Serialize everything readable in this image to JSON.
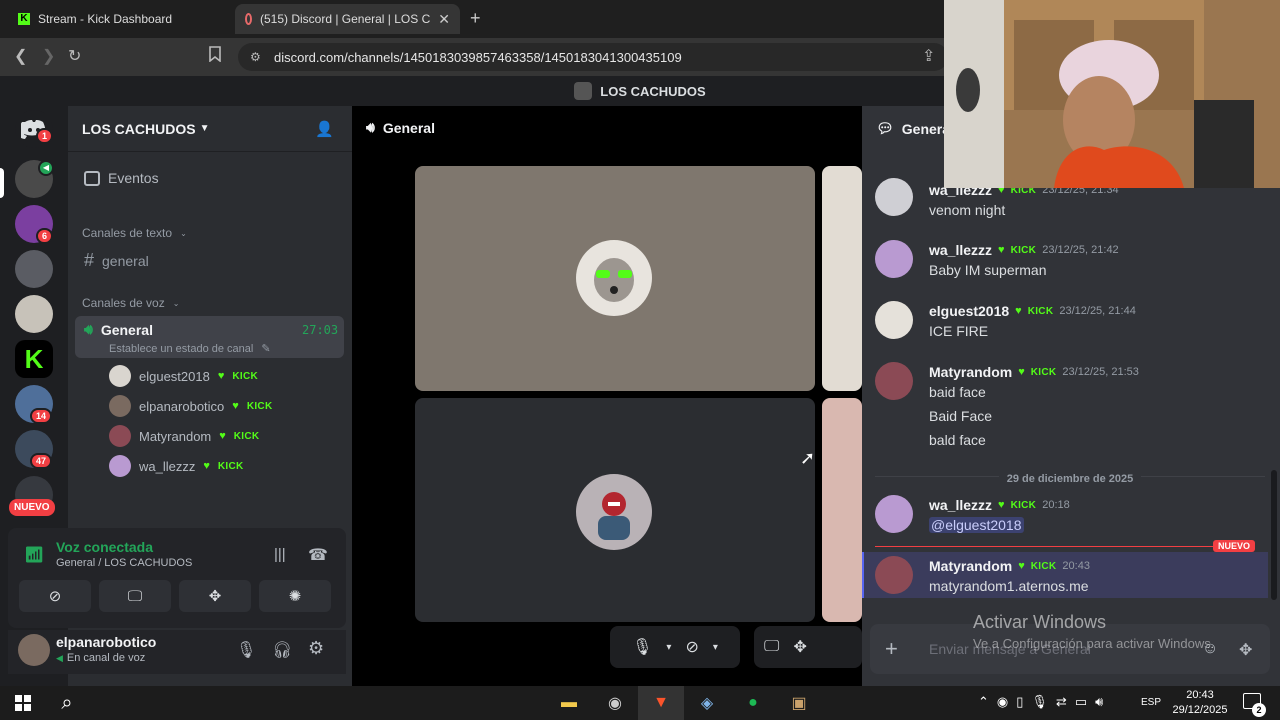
{
  "browser": {
    "tab1_label": "Stream - Kick Dashboard",
    "tab2_label": "(515) Discord | General | LOS C",
    "url": "discord.com/channels/1450183039857463358/1450183041300435109"
  },
  "discord": {
    "window_title": "LOS CACHUDOS",
    "rail_badges": [
      "1",
      "6",
      "14",
      "47"
    ],
    "rail_new_label": "NUEVO",
    "server_name": "LOS CACHUDOS",
    "events_label": "Eventos",
    "text_category": "Canales de texto",
    "text_channel": "general",
    "voice_category": "Canales de voz",
    "voice_channel": "General",
    "voice_timer": "27:03",
    "voice_status": "Establece un estado de canal",
    "voice_users": [
      {
        "name": "elguest2018",
        "tag": "KICK"
      },
      {
        "name": "elpanarobotico",
        "tag": "KICK"
      },
      {
        "name": "Matyrandom",
        "tag": "KICK"
      },
      {
        "name": "wa_llezzz",
        "tag": "KICK"
      }
    ],
    "voice_panel": {
      "title": "Voz conectada",
      "subtitle": "General / LOS CACHUDOS"
    },
    "user": {
      "name": "elpanarobotico",
      "status": "En canal de voz"
    },
    "stage_title": "General",
    "chat_title": "General",
    "messages": [
      {
        "author": "wa_llezzz",
        "tag": "KICK",
        "time": "23/12/25, 21:34",
        "lines": [
          "venom night"
        ]
      },
      {
        "author": "wa_llezzz",
        "tag": "KICK",
        "time": "23/12/25, 21:42",
        "lines": [
          "Baby IM superman"
        ]
      },
      {
        "author": "elguest2018",
        "tag": "KICK",
        "time": "23/12/25, 21:44",
        "lines": [
          "ICE FIRE"
        ]
      },
      {
        "author": "Matyrandom",
        "tag": "KICK",
        "time": "23/12/25, 21:53",
        "lines": [
          "baid face",
          "Baid Face",
          "bald face"
        ]
      },
      {
        "author": "wa_llezzz",
        "tag": "KICK",
        "time": "20:18",
        "lines": [
          "@elguest2018"
        ]
      },
      {
        "author": "Matyrandom",
        "tag": "KICK",
        "time": "20:43",
        "lines": [
          "matyrandom1.aternos.me"
        ]
      }
    ],
    "date_divider": "29 de diciembre de 2025",
    "new_label": "NUEVO",
    "chat_placeholder": "Enviar mensaje a General"
  },
  "watermark": {
    "title": "Activar Windows",
    "subtitle": "Ve a Configuración para activar Windows."
  },
  "taskbar": {
    "lang": "ESP",
    "time": "20:43",
    "date": "29/12/2025",
    "notif": "2"
  },
  "colors": {
    "kick_green": "#53fc18",
    "discord_blurple": "#5865f2",
    "danger": "#f23f43"
  }
}
